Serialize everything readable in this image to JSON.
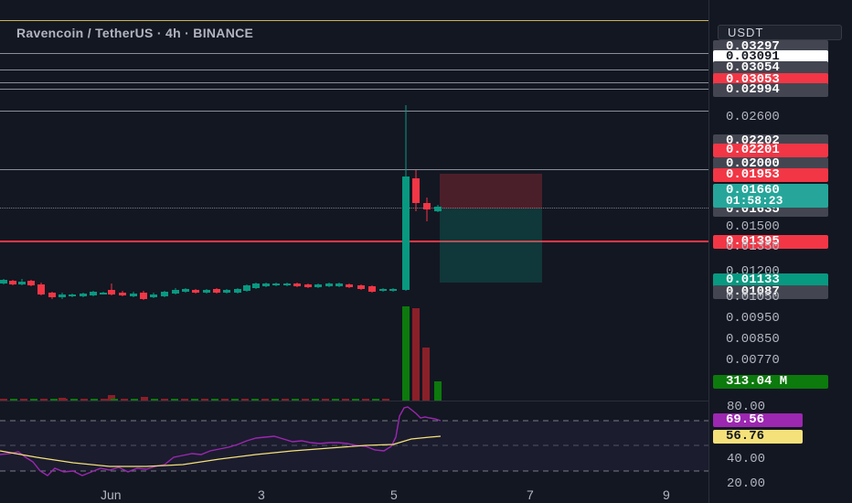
{
  "header": {
    "title": "Ravencoin / TetherUS · 4h · BINANCE",
    "currency": "USDT"
  },
  "price_axis": {
    "labels": [
      {
        "text": "0.03297",
        "style": "gray"
      },
      {
        "text": "0.03091",
        "style": "white"
      },
      {
        "text": "0.03054",
        "style": "gray"
      },
      {
        "text": "0.03053",
        "style": "red"
      },
      {
        "text": "0.02994",
        "style": "gray"
      },
      {
        "text": "0.02600",
        "style": "plain"
      },
      {
        "text": "0.02202",
        "style": "gray"
      },
      {
        "text": "0.02201",
        "style": "red"
      },
      {
        "text": "0.02000",
        "style": "gray"
      },
      {
        "text": "0.01953",
        "style": "red"
      },
      {
        "text": "0.01635",
        "style": "gray"
      },
      {
        "text": "0.01500",
        "style": "plain"
      },
      {
        "text": "0.01395",
        "style": "red"
      },
      {
        "text": "0.01350",
        "style": "plain"
      },
      {
        "text": "0.01200",
        "style": "plain"
      },
      {
        "text": "0.01133",
        "style": "green"
      },
      {
        "text": "0.01087",
        "style": "gray"
      },
      {
        "text": "0.01050",
        "style": "plain"
      },
      {
        "text": "0.00950",
        "style": "plain"
      },
      {
        "text": "0.00850",
        "style": "plain"
      },
      {
        "text": "0.00770",
        "style": "plain"
      }
    ],
    "current_price": "0.01660",
    "countdown": "01:58:23",
    "volume": "313.04 M"
  },
  "rsi": {
    "levels": [
      "80.00",
      "40.00",
      "20.00"
    ],
    "rsi_value": "69.56",
    "ma_value": "56.76",
    "rsi_color": "#9c27b0",
    "ma_color": "#f5e17a"
  },
  "time_axis": [
    "Jun",
    "3",
    "5",
    "7",
    "9"
  ],
  "colors": {
    "up": "#089981",
    "down": "#f23645",
    "volume_up": "#0c7a0c",
    "volume_down": "#8b1f28",
    "background": "#131722"
  }
}
